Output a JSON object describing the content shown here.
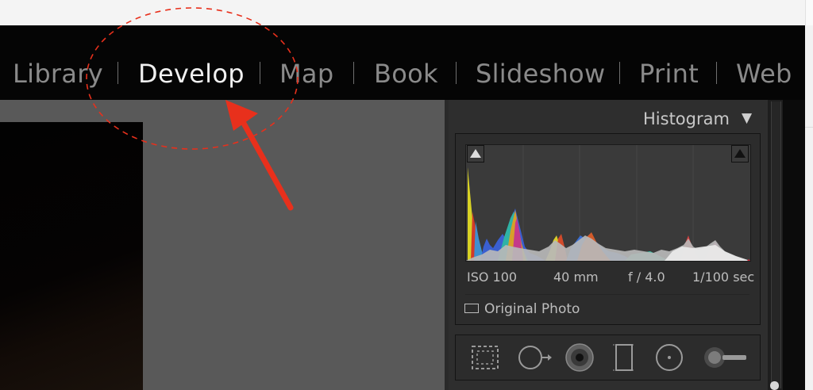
{
  "modules": {
    "items": [
      {
        "label": "Library",
        "active": false
      },
      {
        "label": "Develop",
        "active": true
      },
      {
        "label": "Map",
        "active": false
      },
      {
        "label": "Book",
        "active": false
      },
      {
        "label": "Slideshow",
        "active": false
      },
      {
        "label": "Print",
        "active": false
      },
      {
        "label": "Web",
        "active": false
      }
    ]
  },
  "histogram": {
    "title": "Histogram",
    "toggle_glyph": "▼",
    "iso": "ISO 100",
    "focal_length": "40 mm",
    "aperture": "f / 4.0",
    "shutter": "1/100 sec",
    "original_photo_label": "Original Photo",
    "shadow_clip_icon": "shadow-clipping-icon",
    "highlight_clip_icon": "highlight-clipping-icon"
  },
  "tools": {
    "items": [
      "crop-overlay-icon",
      "spot-removal-icon",
      "red-eye-icon",
      "graduated-filter-icon",
      "radial-filter-icon",
      "adjustment-brush-icon"
    ]
  },
  "colors": {
    "active_module": "#f0f0f0",
    "inactive_module": "#8a8a8a",
    "annotation_red": "#e8301c"
  }
}
